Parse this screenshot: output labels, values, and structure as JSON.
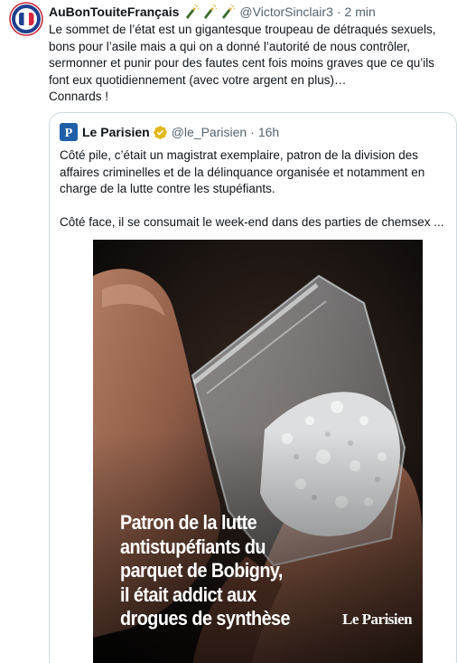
{
  "tweet": {
    "author_name": "AuBonTouiteFrançais",
    "handle": "@VictorSinclair3",
    "separator": "·",
    "time": "2 min",
    "emoji_names": [
      "bottle-popping-icon",
      "bottle-popping-icon",
      "bottle-popping-icon"
    ],
    "avatar_icon": "made-in-france-badge",
    "text": "Le sommet de l’état est un gigantesque troupeau de détraqués sexuels, bons pour l’asile mais a qui on a donné l’autorité de nous contrôler, sermonner et punir pour des fautes cent fois moins graves que ce qu’ils font eux quotidiennement (avec votre argent en plus)…\nConnards !"
  },
  "quote": {
    "author_name": "Le Parisien",
    "handle": "@le_Parisien",
    "separator": "·",
    "time": "16h",
    "avatar_letter": "P",
    "verified_icon": "verified-gold-badge-icon",
    "text": "Côté pile, c’était un magistrat exemplaire, patron de la division des affaires criminelles et de la délinquance organisée et notamment en charge de la lutte contre les stupéfiants.\n\nCôté face, il se consumait le week-end dans des parties de chemsex ...",
    "media": {
      "headline": "Patron de la lutte\nantistupéfiants du\nparquet de Bobigny,\nil était addict aux\ndrogues de synthèse",
      "logo_text": "Le Parisien"
    }
  },
  "colors": {
    "text_primary": "#0f1419",
    "text_secondary": "#536471",
    "border": "#cfd9de",
    "verified_gold": "#e2b719",
    "parisien_blue": "#1f5fa8"
  }
}
